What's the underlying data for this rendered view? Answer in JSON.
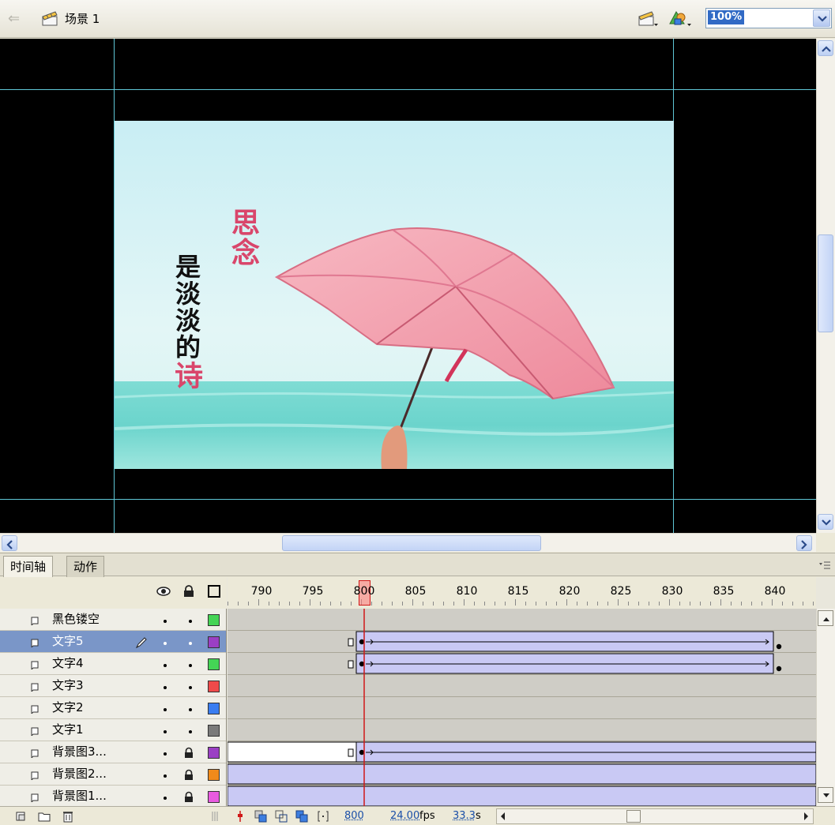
{
  "scene_bar": {
    "scene_label": "场景 1",
    "zoom": "100%"
  },
  "stage": {
    "poem_line_1": "思念",
    "poem_line_2_main": "是淡淡的",
    "poem_line_2_highlight": "诗"
  },
  "panel_tabs": [
    {
      "label": "时间轴"
    },
    {
      "label": "动作"
    }
  ],
  "timeline": {
    "frame_numbers": [
      "790",
      "795",
      "800",
      "805",
      "810",
      "815",
      "820",
      "825",
      "830",
      "835",
      "840"
    ],
    "current_frame": "800",
    "frame_rate": "24.00",
    "frame_rate_unit": "fps",
    "elapsed": "33.3",
    "elapsed_unit": "s",
    "layers": [
      {
        "name": "黑色镂空",
        "color": "#44d455",
        "locked": false,
        "selected": false
      },
      {
        "name": "文字5",
        "color": "#9b3fc4",
        "locked": false,
        "selected": true
      },
      {
        "name": "文字4",
        "color": "#44d455",
        "locked": false,
        "selected": false
      },
      {
        "name": "文字3",
        "color": "#ef4a4a",
        "locked": false,
        "selected": false
      },
      {
        "name": "文字2",
        "color": "#3a7df0",
        "locked": false,
        "selected": false
      },
      {
        "name": "文字1",
        "color": "#7a7a7a",
        "locked": false,
        "selected": false
      },
      {
        "name": "背景图3...",
        "color": "#9b3fc4",
        "locked": true,
        "selected": false
      },
      {
        "name": "背景图2...",
        "color": "#f08a1a",
        "locked": true,
        "selected": false
      },
      {
        "name": "背景图1...",
        "color": "#e85be0",
        "locked": true,
        "selected": false
      }
    ]
  }
}
